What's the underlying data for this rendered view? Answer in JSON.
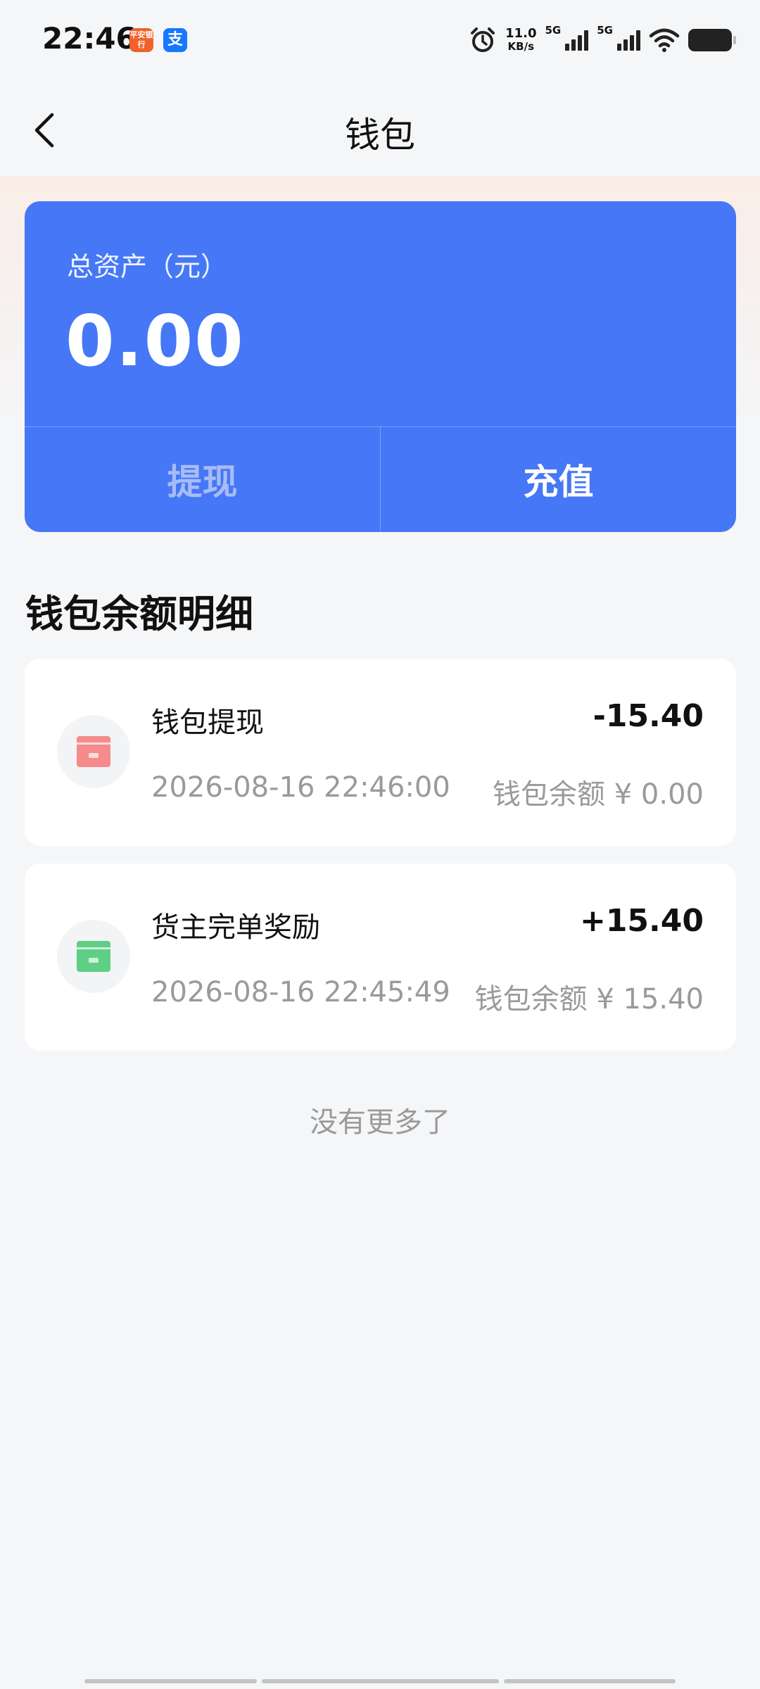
{
  "status_bar": {
    "time": "22:46",
    "app_badges": [
      {
        "label": "平安银行",
        "color": "#f0622a"
      },
      {
        "label": "支",
        "color": "#1677ff"
      }
    ],
    "net_speed_value": "11.0",
    "net_speed_unit": "KB/s",
    "sim1_label": "5G",
    "sim2_label": "5G",
    "icons": [
      "alarm-icon",
      "signal-icon",
      "signal-icon",
      "wifi-icon",
      "battery-icon"
    ]
  },
  "nav": {
    "title": "钱包",
    "back_icon": "chevron-left-icon"
  },
  "asset_card": {
    "label": "总资产（元）",
    "amount": "0.00",
    "withdraw_label": "提现",
    "recharge_label": "充值",
    "card_color": "#4677f6"
  },
  "section": {
    "title": "钱包余额明细"
  },
  "records": [
    {
      "title": "钱包提现",
      "amount": "-15.40",
      "time": "2026-08-16 22:46:00",
      "balance": "钱包余额 ¥ 0.00",
      "icon_color": "#f58b8b",
      "icon": "withdraw-card-icon"
    },
    {
      "title": "货主完单奖励",
      "amount": "+15.40",
      "time": "2026-08-16 22:45:49",
      "balance": "钱包余额 ¥ 15.40",
      "icon_color": "#5fcf85",
      "icon": "reward-card-icon"
    }
  ],
  "footer": {
    "no_more": "没有更多了"
  }
}
